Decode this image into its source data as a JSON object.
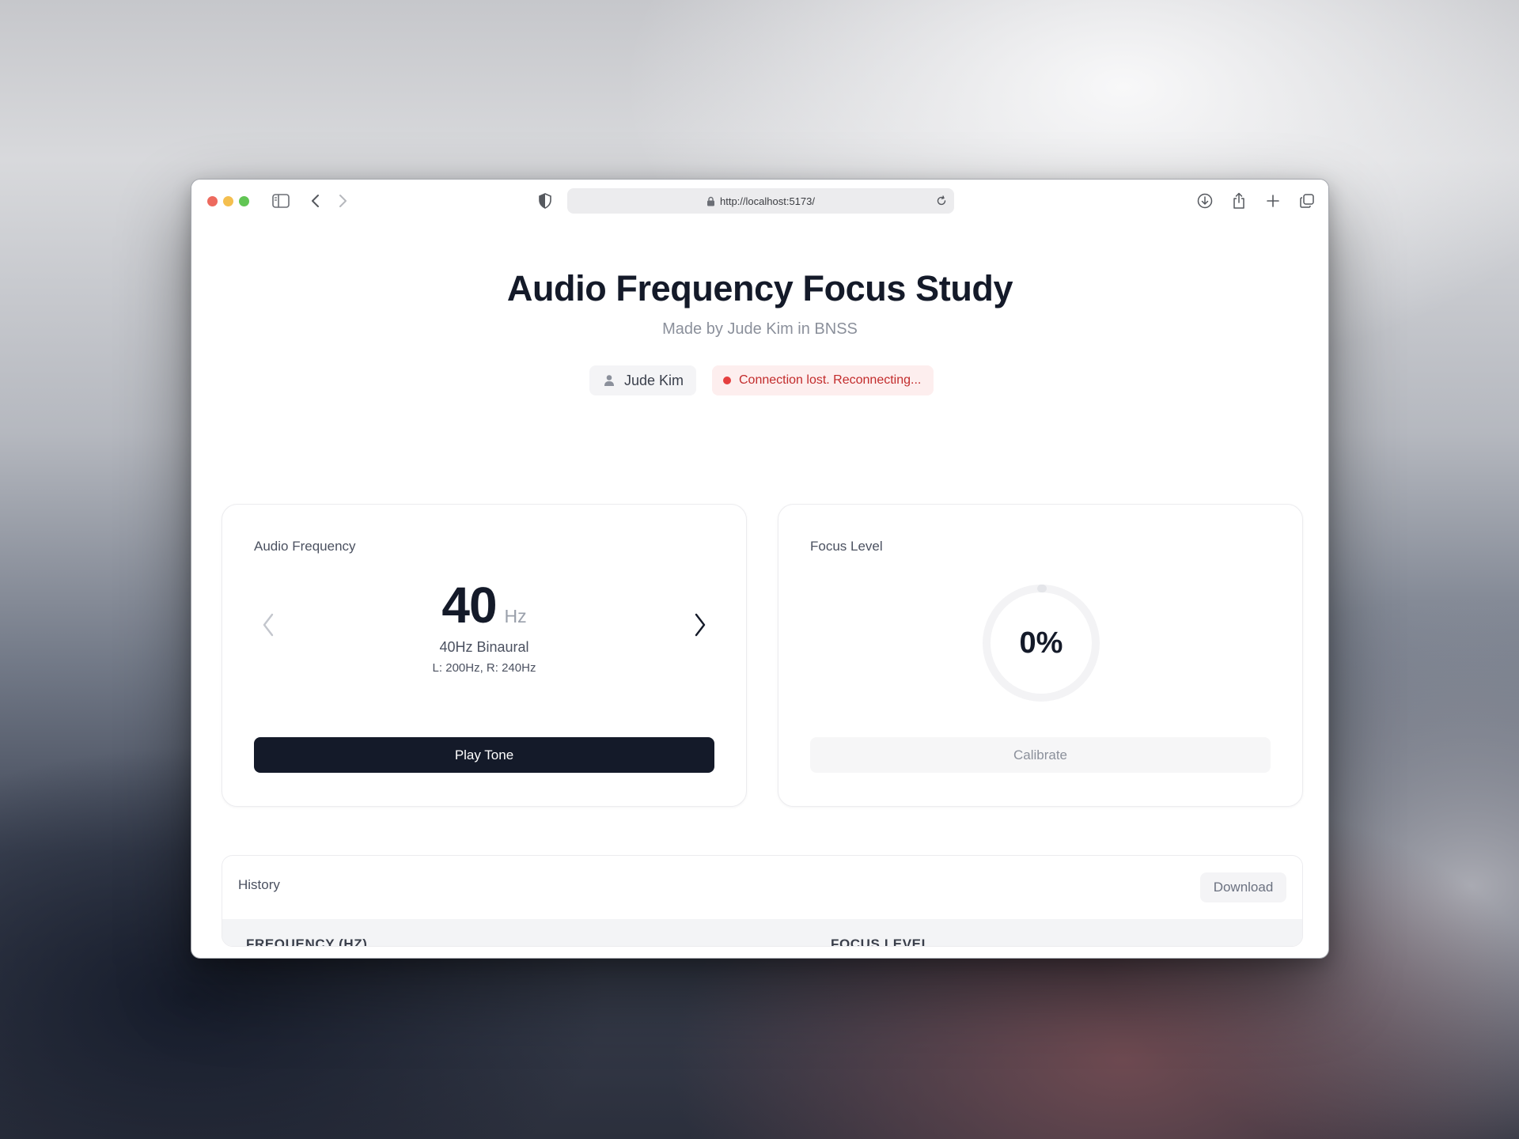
{
  "browser": {
    "url": "http://localhost:5173/"
  },
  "header": {
    "title": "Audio Frequency Focus Study",
    "subtitle": "Made by Jude Kim in BNSS"
  },
  "user_chip": {
    "name": "Jude Kim"
  },
  "status": {
    "text": "Connection lost. Reconnecting...",
    "color": "#e53e3e"
  },
  "frequency_card": {
    "label": "Audio Frequency",
    "value": "40",
    "unit": "Hz",
    "name": "40Hz Binaural",
    "detail": "L: 200Hz, R: 240Hz",
    "play_label": "Play Tone"
  },
  "focus_card": {
    "label": "Focus Level",
    "value_text": "0%",
    "value_fraction": 0,
    "calibrate_label": "Calibrate"
  },
  "history": {
    "title": "History",
    "download_label": "Download",
    "columns": [
      "FREQUENCY (HZ)",
      "FOCUS LEVEL"
    ]
  },
  "colors": {
    "primary": "#141a29",
    "error": "#c22b2b",
    "error_bg": "#fdeeee"
  }
}
